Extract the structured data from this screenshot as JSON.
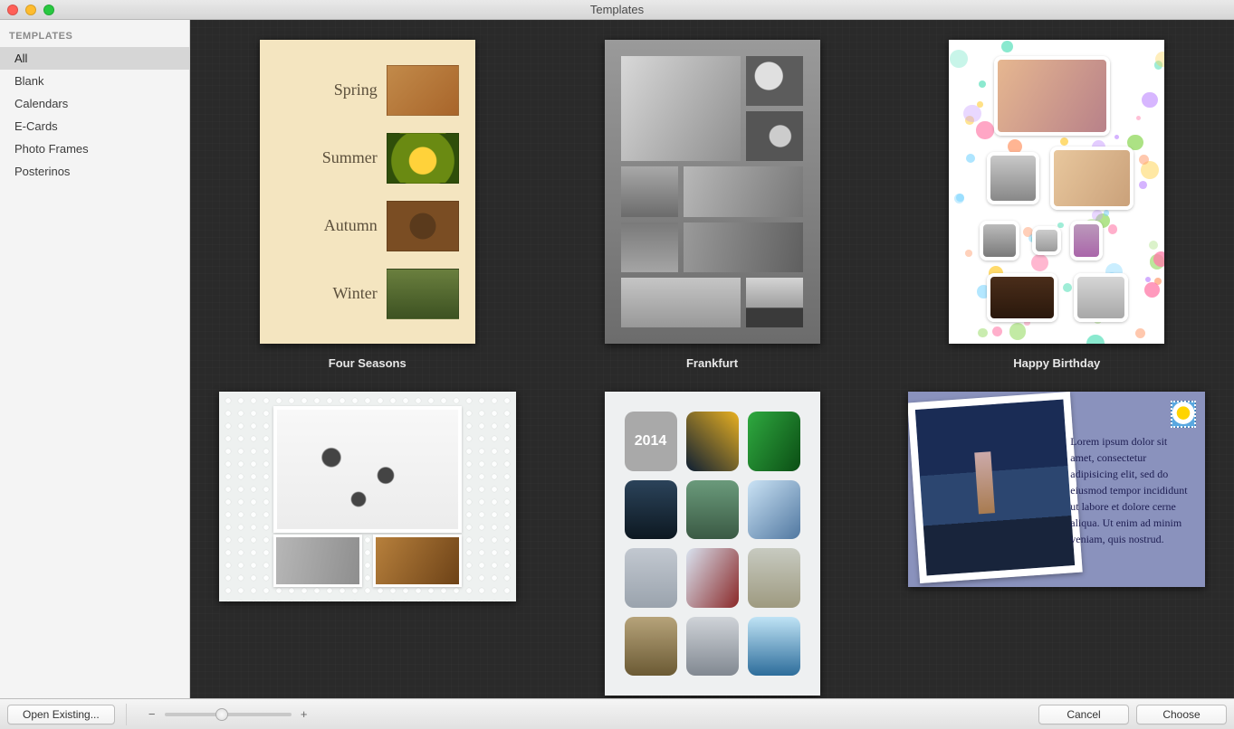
{
  "window": {
    "title": "Templates"
  },
  "sidebar": {
    "header": "TEMPLATES",
    "items": [
      {
        "label": "All",
        "selected": true
      },
      {
        "label": "Blank",
        "selected": false
      },
      {
        "label": "Calendars",
        "selected": false
      },
      {
        "label": "E-Cards",
        "selected": false
      },
      {
        "label": "Photo Frames",
        "selected": false
      },
      {
        "label": "Posterinos",
        "selected": false
      }
    ]
  },
  "templates": [
    {
      "name": "Four Seasons"
    },
    {
      "name": "Frankfurt"
    },
    {
      "name": "Happy Birthday"
    }
  ],
  "four_seasons": {
    "rows": [
      "Spring",
      "Summer",
      "Autumn",
      "Winter"
    ]
  },
  "grid2014": {
    "year": "2014"
  },
  "postcard": {
    "text": "Lorem ipsum dolor sit amet, consectetur adipisicing elit, sed do eiusmod tempor incididunt ut labore et dolore cerne aliqua. Ut enim ad minim veniam, quis nostrud."
  },
  "footer": {
    "open_existing": "Open Existing...",
    "cancel": "Cancel",
    "choose": "Choose",
    "zoom_minus": "−",
    "zoom_plus": "+",
    "zoom_value_pct": 45
  }
}
